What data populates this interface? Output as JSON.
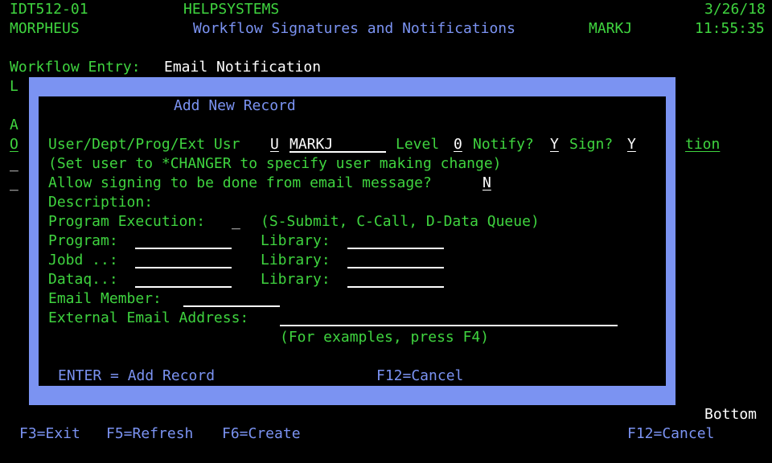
{
  "header": {
    "screen_id": "IDT512-01",
    "system_name": "MORPHEUS",
    "company": "HELPSYSTEMS",
    "screen_title": "Workflow Signatures and Notifications",
    "user": "MARKJ",
    "date": "3/26/18",
    "time": "11:55:35"
  },
  "workflow_entry": {
    "label": "Workflow Entry:",
    "value": "Email Notification"
  },
  "background": {
    "left_chars": [
      "L",
      "A",
      "O",
      "_",
      "_"
    ],
    "right_text": "tion"
  },
  "popup": {
    "title": "Add New Record",
    "user_type_label": "User/Dept/Prog/Ext Usr",
    "user_type_value": "U",
    "user_value": "MARKJ",
    "level_label": "Level",
    "level_value": "0",
    "notify_label": "Notify?",
    "notify_value": "Y",
    "sign_label": "Sign?",
    "sign_value": "Y",
    "changer_hint": "(Set user to *CHANGER to specify user making change)",
    "allow_sign_label": "Allow signing to be done from email message?",
    "allow_sign_value": "N",
    "description_label": "Description:",
    "prog_exec_label": "Program Execution:",
    "prog_exec_value": "_",
    "prog_exec_hint": "(S-Submit, C-Call, D-Data Queue)",
    "program_label": "Program:",
    "jobd_label": "Jobd ..:",
    "dataq_label": "Dataq..:",
    "library_label": "Library:",
    "email_member_label": "Email Member:",
    "external_email_label": "External Email Address:",
    "examples_hint": "(For examples, press F4)",
    "enter_key": "ENTER = Add Record",
    "cancel_key": "F12=Cancel"
  },
  "footer": {
    "bottom_indicator": "Bottom",
    "f3": "F3=Exit",
    "f5": "F5=Refresh",
    "f6": "F6=Create",
    "f12": "F12=Cancel"
  },
  "colors": {
    "green": "#3fd43f",
    "white": "#ffffff",
    "blue": "#7b93f2",
    "background": "#000000"
  }
}
